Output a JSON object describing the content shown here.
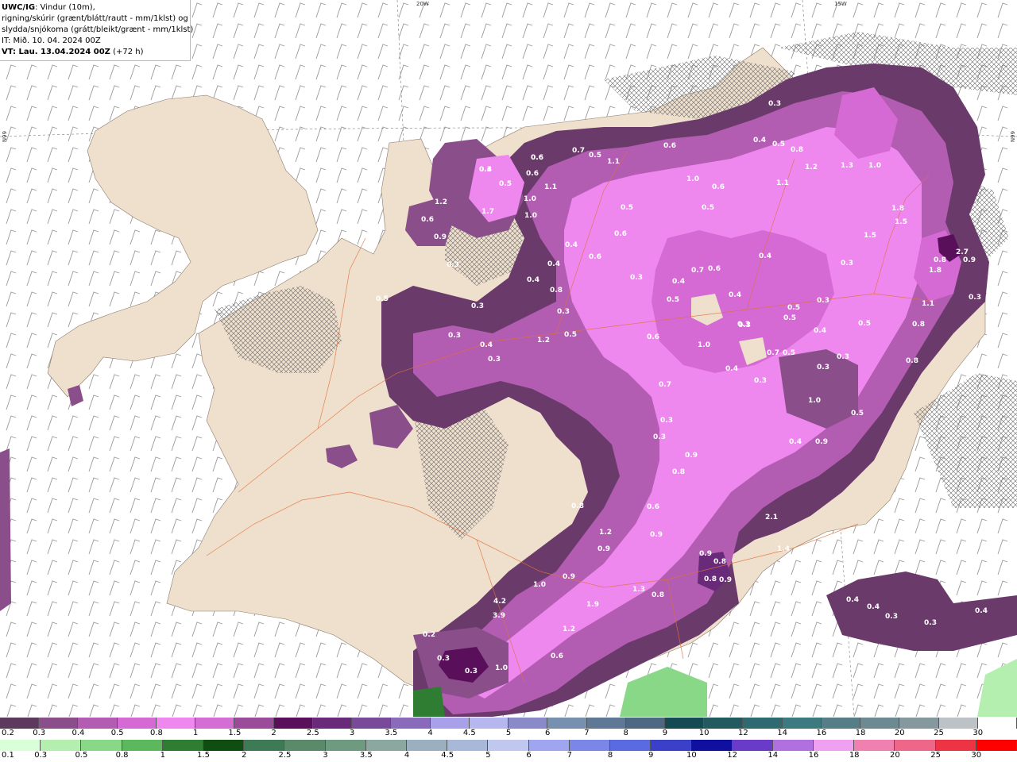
{
  "header": {
    "product": "UWC/IG",
    "line1_rest": ": Vindur (10m),",
    "line2": "rigning/skúrir (grænt/blátt/rautt - mm/1klst) og",
    "line3": "slydda/snjókoma (grátt/bleikt/grænt - mm/1klst)",
    "it_line": "IT: Mið. 10. 04. 2024 00Z",
    "vt_label": "VT: Lau. 13.04.2024 00Z",
    "vt_offset": " (+72 h)"
  },
  "grid_labels": {
    "lon_20w": "20W",
    "lon_15w": "15W",
    "lat_66n_left": "66N",
    "lat_66n_right": "66N"
  },
  "map_values": [
    {
      "v": "0.3"
    },
    {
      "v": "0.6"
    },
    {
      "v": "0.6"
    },
    {
      "v": "0.5"
    },
    {
      "v": "1.0"
    },
    {
      "v": "1.0"
    },
    {
      "v": "1.1"
    },
    {
      "v": "0.7"
    },
    {
      "v": "0.5"
    },
    {
      "v": "1.1"
    },
    {
      "v": "0.5"
    },
    {
      "v": "0.6"
    },
    {
      "v": "1.0"
    },
    {
      "v": "0.6"
    },
    {
      "v": "0.5"
    },
    {
      "v": "0.3"
    },
    {
      "v": "0.4"
    },
    {
      "v": "0.5"
    },
    {
      "v": "0.8"
    },
    {
      "v": "1.2"
    },
    {
      "v": "1.3"
    },
    {
      "v": "1.0"
    },
    {
      "v": "1.1"
    },
    {
      "v": "1.8"
    },
    {
      "v": "1.5"
    },
    {
      "v": "1.5"
    },
    {
      "v": "2.7"
    },
    {
      "v": "0.9"
    },
    {
      "v": "1.8"
    },
    {
      "v": "0.4"
    },
    {
      "v": "0.3"
    },
    {
      "v": "0.3"
    },
    {
      "v": "0.5"
    },
    {
      "v": "0.4"
    },
    {
      "v": "0.3"
    },
    {
      "v": "0.5"
    },
    {
      "v": "1.1"
    },
    {
      "v": "0.8"
    },
    {
      "v": "0.8"
    },
    {
      "v": "0.7"
    },
    {
      "v": "0.6"
    },
    {
      "v": "0.5"
    },
    {
      "v": "0.4"
    },
    {
      "v": "0.3"
    },
    {
      "v": "1.0"
    },
    {
      "v": "0.6"
    },
    {
      "v": "0.7"
    },
    {
      "v": "0.5"
    },
    {
      "v": "0.3"
    },
    {
      "v": "0.4"
    },
    {
      "v": "0.4"
    },
    {
      "v": "0.4"
    },
    {
      "v": "0.6"
    },
    {
      "v": "0.6"
    },
    {
      "v": "0.3"
    },
    {
      "v": "0.4"
    },
    {
      "v": "0.3"
    },
    {
      "v": "0.5"
    },
    {
      "v": "0.3"
    },
    {
      "v": "0.3"
    },
    {
      "v": "0.3"
    },
    {
      "v": "0.4"
    },
    {
      "v": "0.7"
    },
    {
      "v": "0.5"
    },
    {
      "v": "1.0"
    },
    {
      "v": "0.5"
    },
    {
      "v": "0.9"
    },
    {
      "v": "0.4"
    },
    {
      "v": "0.3"
    },
    {
      "v": "0.3"
    },
    {
      "v": "0.9"
    },
    {
      "v": "0.8"
    },
    {
      "v": "0.6"
    },
    {
      "v": "1.2"
    },
    {
      "v": "0.9"
    },
    {
      "v": "0.8"
    },
    {
      "v": "0.9"
    },
    {
      "v": "0.9"
    },
    {
      "v": "0.8"
    },
    {
      "v": "0.8"
    },
    {
      "v": "0.9"
    },
    {
      "v": "0.8"
    },
    {
      "v": "0.8"
    },
    {
      "v": "1.2"
    },
    {
      "v": "1.0"
    },
    {
      "v": "0.9"
    },
    {
      "v": "1.3"
    },
    {
      "v": "0.8"
    },
    {
      "v": "1.9"
    },
    {
      "v": "1.7"
    },
    {
      "v": "2.6"
    },
    {
      "v": "2.1"
    },
    {
      "v": "1.4"
    },
    {
      "v": "0.4"
    },
    {
      "v": "0.4"
    },
    {
      "v": "0.3"
    },
    {
      "v": "0.3"
    },
    {
      "v": "0.4"
    },
    {
      "v": "0.2"
    },
    {
      "v": "0.3"
    },
    {
      "v": "0.3"
    },
    {
      "v": "1.0"
    },
    {
      "v": "1.2"
    },
    {
      "v": "0.6"
    },
    {
      "v": "4.2"
    },
    {
      "v": "3.9"
    },
    {
      "v": "1.7"
    },
    {
      "v": "1.2"
    },
    {
      "v": "0.6"
    },
    {
      "v": "0.9"
    },
    {
      "v": "0.3"
    },
    {
      "v": "0.3"
    },
    {
      "v": "0.5"
    },
    {
      "v": "0.3"
    },
    {
      "v": "0.4"
    },
    {
      "v": "0.3"
    },
    {
      "v": "0.4"
    },
    {
      "v": "0.6"
    }
  ],
  "legend_snow": {
    "labels": [
      "0.2",
      "0.3",
      "0.4",
      "0.5",
      "0.8",
      "1",
      "1.5",
      "2",
      "2.5",
      "3",
      "3.5",
      "4",
      "4.5",
      "5",
      "6",
      "7",
      "8",
      "9",
      "10",
      "12",
      "14",
      "16",
      "18",
      "20",
      "25",
      "30"
    ],
    "colors": [
      "#5d3a5d",
      "#8a4f8a",
      "#b25cb2",
      "#d56ad5",
      "#ee88ee",
      "#d46ed4",
      "#9a4c9a",
      "#5a0f5a",
      "#6a2a7a",
      "#7a4a9a",
      "#8a6aba",
      "#a8a0e8",
      "#b7b7ef",
      "#8a8ac8",
      "#7790b0",
      "#5f7896",
      "#4e6884",
      "#164a52",
      "#225a60",
      "#2f6a70",
      "#3d7a80",
      "#567e86",
      "#6d8a92",
      "#84989e",
      "#bcc2c5",
      "#ffffff"
    ]
  },
  "legend_rain": {
    "labels": [
      "0.1",
      "0.3",
      "0.5",
      "0.8",
      "1",
      "1.5",
      "2",
      "2.5",
      "3",
      "3.5",
      "4",
      "4.5",
      "5",
      "6",
      "7",
      "8",
      "9",
      "10",
      "12",
      "14",
      "16",
      "18",
      "20",
      "25",
      "30"
    ],
    "colors": [
      "#d8ffd8",
      "#b5efb0",
      "#88d888",
      "#5cb85c",
      "#2e7d32",
      "#104d10",
      "#3e7a55",
      "#5a8a6a",
      "#6e9a80",
      "#8aa8a0",
      "#9ab0c0",
      "#a8b8d8",
      "#c0c8f0",
      "#9fa6ef",
      "#7a86e8",
      "#5a6ae0",
      "#3a40c8",
      "#1010a0",
      "#6a3ac8",
      "#b070e0",
      "#f0a0f0",
      "#f080b0",
      "#ee6688",
      "#ee3344",
      "#ff0000"
    ]
  }
}
